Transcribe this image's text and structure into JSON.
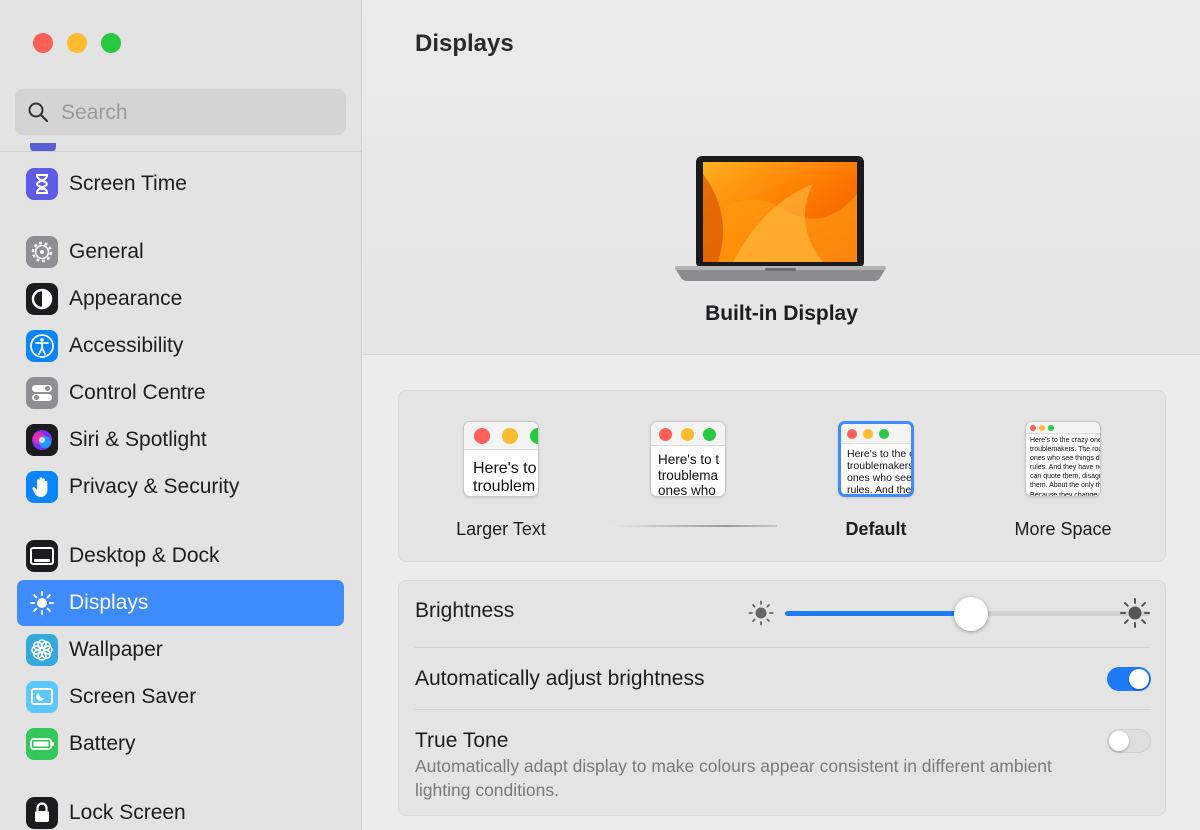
{
  "window": {
    "traffic_lights": {
      "close_color": "#fe5f57",
      "minimize_color": "#febc2e",
      "zoom_color": "#28c840"
    }
  },
  "sidebar": {
    "search_placeholder": "Search",
    "items": [
      {
        "label": "Screen Time",
        "icon": "hourglass-icon"
      },
      {
        "label": "General",
        "icon": "gear-icon"
      },
      {
        "label": "Appearance",
        "icon": "appearance-icon"
      },
      {
        "label": "Accessibility",
        "icon": "accessibility-icon"
      },
      {
        "label": "Control Centre",
        "icon": "control-centre-icon"
      },
      {
        "label": "Siri & Spotlight",
        "icon": "siri-icon"
      },
      {
        "label": "Privacy & Security",
        "icon": "hand-icon"
      },
      {
        "label": "Desktop & Dock",
        "icon": "dock-icon"
      },
      {
        "label": "Displays",
        "icon": "sun-icon",
        "selected": true
      },
      {
        "label": "Wallpaper",
        "icon": "flower-icon"
      },
      {
        "label": "Screen Saver",
        "icon": "screen-saver-icon"
      },
      {
        "label": "Battery",
        "icon": "battery-icon"
      },
      {
        "label": "Lock Screen",
        "icon": "lock-icon"
      }
    ],
    "accent_color": "#3d8bfc"
  },
  "main": {
    "title": "Displays",
    "display_name": "Built-in Display",
    "resolution_options": [
      {
        "label": "Larger Text",
        "preview": "Here's to\ntroublem"
      },
      {
        "label": "",
        "preview": "Here's to t\ntroublema\nones who"
      },
      {
        "label": "Default",
        "preview": "Here's to the c\ntroublemakers.\nones who see t\nrules. And they",
        "selected": true
      },
      {
        "label": "More Space",
        "preview": "Here's to the crazy one\ntroublemakers. The rou\nones who see things di\nrules. And they have no\ncan quote them, disagr\nthem. About the only th\nBecause they change th"
      }
    ],
    "brightness": {
      "label": "Brightness",
      "value_percent": 51
    },
    "auto_brightness": {
      "label": "Automatically adjust brightness",
      "enabled": true
    },
    "true_tone": {
      "label": "True Tone",
      "description": "Automatically adapt display to make colours appear consistent in different ambient lighting conditions.",
      "enabled": false
    },
    "toggle_on_color": "#1e7bf6"
  }
}
